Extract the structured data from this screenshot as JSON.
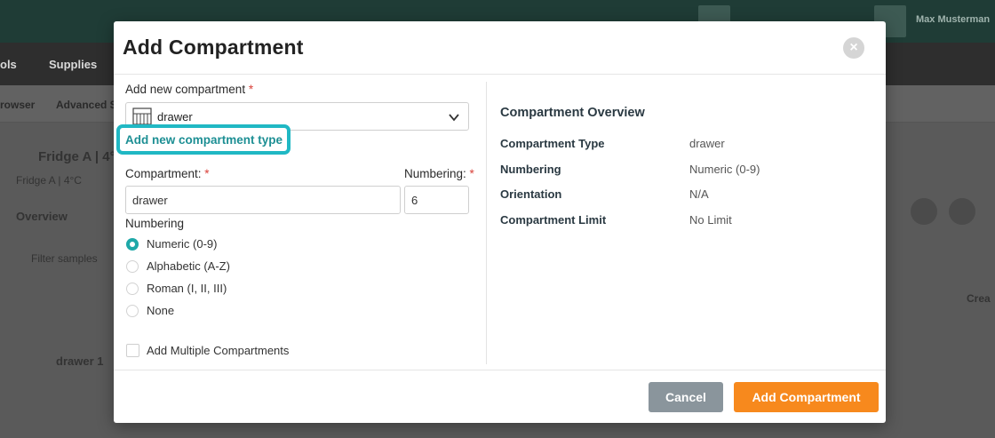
{
  "background": {
    "user_name": "Max Musterman",
    "nav_items": [
      "ols",
      "Supplies"
    ],
    "tabs": [
      "rowser",
      "Advanced S"
    ],
    "location_title": "Fridge A | 4°",
    "location_subtitle": "Fridge A | 4°C",
    "content_tabs": [
      "Overview"
    ],
    "filter_placeholder": "Filter samples",
    "row_item": "drawer 1",
    "create_label": "Crea"
  },
  "modal": {
    "title": "Add Compartment",
    "close_label": "×",
    "add_new_compartment_label": "Add new compartment",
    "required_mark": "*",
    "select_value": "drawer",
    "add_type_link": "Add new compartment type",
    "compartment_label": "Compartment:",
    "compartment_value": "drawer",
    "numbering_field_label": "Numbering:",
    "numbering_value": "6",
    "numbering_group_label": "Numbering",
    "numbering_options": [
      {
        "label": "Numeric (0-9)",
        "checked": true
      },
      {
        "label": "Alphabetic (A-Z)",
        "checked": false
      },
      {
        "label": "Roman (I, II, III)",
        "checked": false
      },
      {
        "label": "None",
        "checked": false
      }
    ],
    "add_multiple_label": "Add Multiple Compartments",
    "overview": {
      "title": "Compartment Overview",
      "rows": [
        {
          "key": "Compartment Type",
          "value": "drawer"
        },
        {
          "key": "Numbering",
          "value": "Numeric (0-9)"
        },
        {
          "key": "Orientation",
          "value": "N/A"
        },
        {
          "key": "Compartment Limit",
          "value": "No Limit"
        }
      ]
    },
    "cancel_label": "Cancel",
    "submit_label": "Add Compartment"
  },
  "colors": {
    "accent": "#1ea8a8",
    "highlight": "#20b8c4",
    "primary_button": "#f7891d",
    "cancel_button": "#8a959c"
  }
}
